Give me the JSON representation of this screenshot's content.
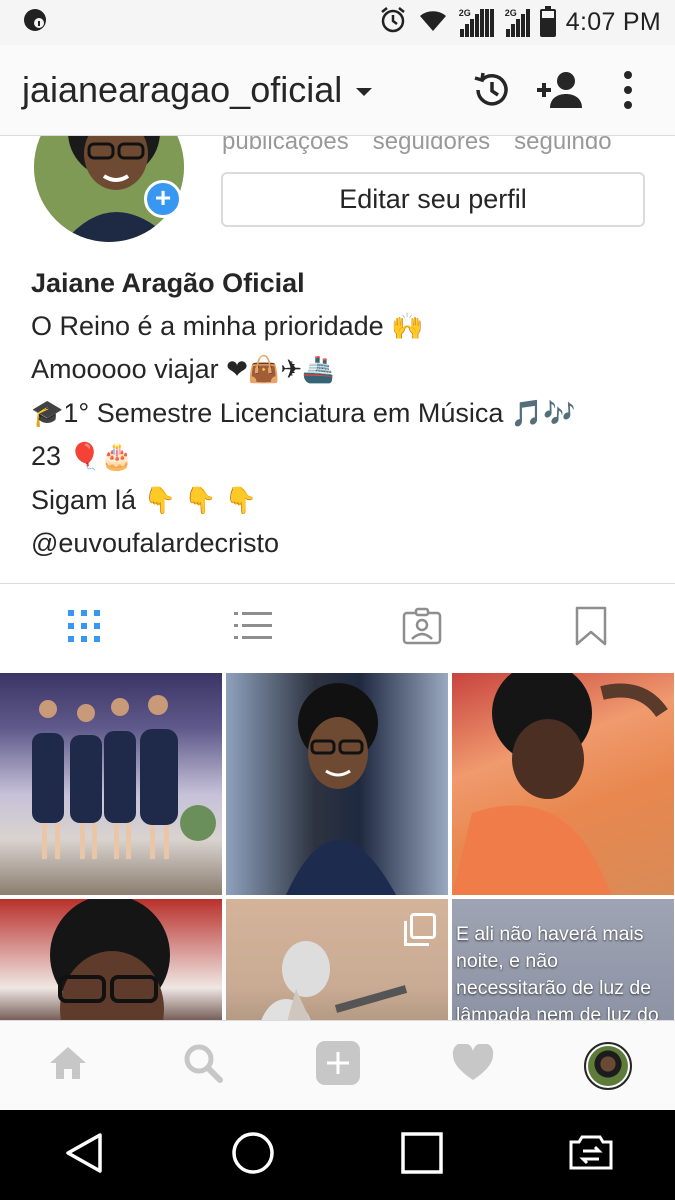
{
  "status_bar": {
    "time": "4:07 PM",
    "network_tag_1": "2G",
    "network_tag_2": "2G",
    "icons": [
      "vpn-icon",
      "alarm-icon",
      "wifi-icon",
      "signal-icon",
      "signal-icon",
      "battery-icon"
    ]
  },
  "header": {
    "username": "jaianearagao_oficial",
    "icons": [
      "chevron-down-icon",
      "history-icon",
      "add-person-icon",
      "more-icon"
    ]
  },
  "profile": {
    "stat_labels": [
      "publicações",
      "seguidores",
      "seguindo"
    ],
    "edit_button": "Editar seu perfil"
  },
  "bio": {
    "name": "Jaiane Aragão Oficial",
    "line1_text": "O Reino é a minha prioridade",
    "line1_emoji": "🙌",
    "line2_text": "Amooooo viajar",
    "line2_emoji": "❤👜✈🚢",
    "line3_prefix": "🎓",
    "line3_text": "1° Semestre Licenciatura em Música",
    "line3_emoji": "🎵🎶",
    "line4_text": "23",
    "line4_emoji": "🎈🎂",
    "line5_text": "Sigam lá",
    "line5_emoji": "👇 👇 👇",
    "line6_text": "@euvoufalardecristo"
  },
  "tabs": [
    {
      "name": "grid-icon",
      "active": true
    },
    {
      "name": "list-icon",
      "active": false
    },
    {
      "name": "tagged-icon",
      "active": false
    },
    {
      "name": "saved-icon",
      "active": false
    }
  ],
  "grid": {
    "quote_text": "E ali não haverá mais noite, e não necessitarão de luz de lâmpada nem de luz do sol, porque o Senhor Deus"
  },
  "bottom_nav": [
    "home-icon",
    "search-icon",
    "add-post-icon",
    "heart-icon",
    "profile-avatar"
  ],
  "system_nav": [
    "back-icon",
    "home-circle-icon",
    "recents-icon",
    "screen-rotate-icon"
  ],
  "colors": {
    "accent": "#3897f0",
    "text": "#262626",
    "muted": "#999999",
    "divider": "#dbdbdb"
  }
}
